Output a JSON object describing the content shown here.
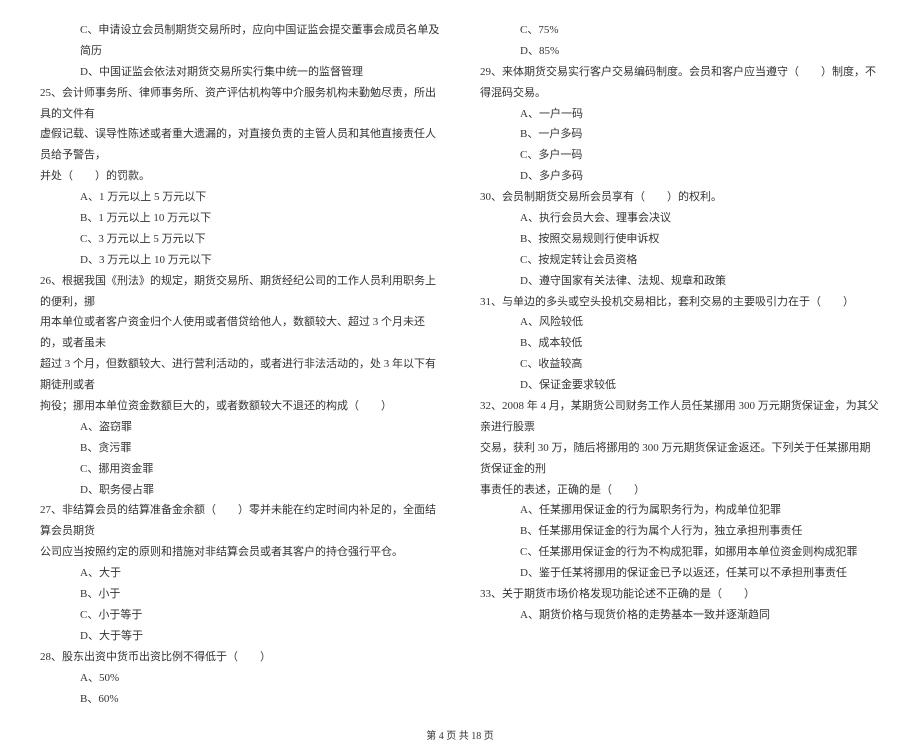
{
  "left": {
    "opt24c": "C、申请设立会员制期货交易所时，应向中国证监会提交董事会成员名单及简历",
    "opt24d": "D、中国证监会依法对期货交易所实行集中统一的监督管理",
    "q25_1": "25、会计师事务所、律师事务所、资产评估机构等中介服务机构未勤勉尽责，所出具的文件有",
    "q25_2": "虚假记载、误导性陈述或者重大遗漏的，对直接负责的主管人员和其他直接责任人员给予警告，",
    "q25_3": "并处（　　）的罚款。",
    "opt25a": "A、1 万元以上 5 万元以下",
    "opt25b": "B、1 万元以上 10 万元以下",
    "opt25c": "C、3 万元以上 5 万元以下",
    "opt25d": "D、3 万元以上 10 万元以下",
    "q26_1": "26、根据我国《刑法》的规定，期货交易所、期货经纪公司的工作人员利用职务上的便利，挪",
    "q26_2": "用本单位或者客户资金归个人使用或者借贷给他人，数额较大、超过 3 个月未还的，或者虽未",
    "q26_3": "超过 3 个月，但数额较大、进行营利活动的，或者进行非法活动的，处 3 年以下有期徒刑或者",
    "q26_4": "拘役；挪用本单位资金数额巨大的，或者数额较大不退还的构成（　　）",
    "opt26a": "A、盗窃罪",
    "opt26b": "B、贪污罪",
    "opt26c": "C、挪用资金罪",
    "opt26d": "D、职务侵占罪",
    "q27_1": "27、非结算会员的结算准备金余额（　　）零并未能在约定时间内补足的，全面结算会员期货",
    "q27_2": "公司应当按照约定的原则和措施对非结算会员或者其客户的持仓强行平仓。",
    "opt27a": "A、大于",
    "opt27b": "B、小于",
    "opt27c": "C、小于等于",
    "opt27d": "D、大于等于",
    "q28": "28、股东出资中货币出资比例不得低于（　　）",
    "opt28a": "A、50%",
    "opt28b": "B、60%"
  },
  "right": {
    "opt28c": "C、75%",
    "opt28d": "D、85%",
    "q29": "29、来体期货交易实行客户交易编码制度。会员和客户应当遵守（　　）制度，不得混码交易。",
    "opt29a": "A、一户一码",
    "opt29b": "B、一户多码",
    "opt29c": "C、多户一码",
    "opt29d": "D、多户多码",
    "q30": "30、会员制期货交易所会员享有（　　）的权利。",
    "opt30a": "A、执行会员大会、理事会决议",
    "opt30b": "B、按照交易规则行使申诉权",
    "opt30c": "C、按规定转让会员资格",
    "opt30d": "D、遵守国家有关法律、法规、规章和政策",
    "q31": "31、与单边的多头或空头投机交易相比，套利交易的主要吸引力在于（　　）",
    "opt31a": "A、风险较低",
    "opt31b": "B、成本较低",
    "opt31c": "C、收益较高",
    "opt31d": "D、保证金要求较低",
    "q32_1": "32、2008 年 4 月，某期货公司财务工作人员任某挪用 300 万元期货保证金，为其父亲进行股票",
    "q32_2": "交易，获利 30 万，随后将挪用的 300 万元期货保证金返还。下列关于任某挪用期货保证金的刑",
    "q32_3": "事责任的表述，正确的是（　　）",
    "opt32a": "A、任某挪用保证金的行为属职务行为，构成单位犯罪",
    "opt32b": "B、任某挪用保证金的行为属个人行为，独立承担刑事责任",
    "opt32c": "C、任某挪用保证金的行为不构成犯罪，如挪用本单位资金则构成犯罪",
    "opt32d": "D、鉴于任某将挪用的保证金已予以返还，任某可以不承担刑事责任",
    "q33": "33、关于期货市场价格发现功能论述不正确的是（　　）",
    "opt33a": "A、期货价格与现货价格的走势基本一致并逐渐趋同"
  },
  "footer": "第 4 页 共 18 页"
}
